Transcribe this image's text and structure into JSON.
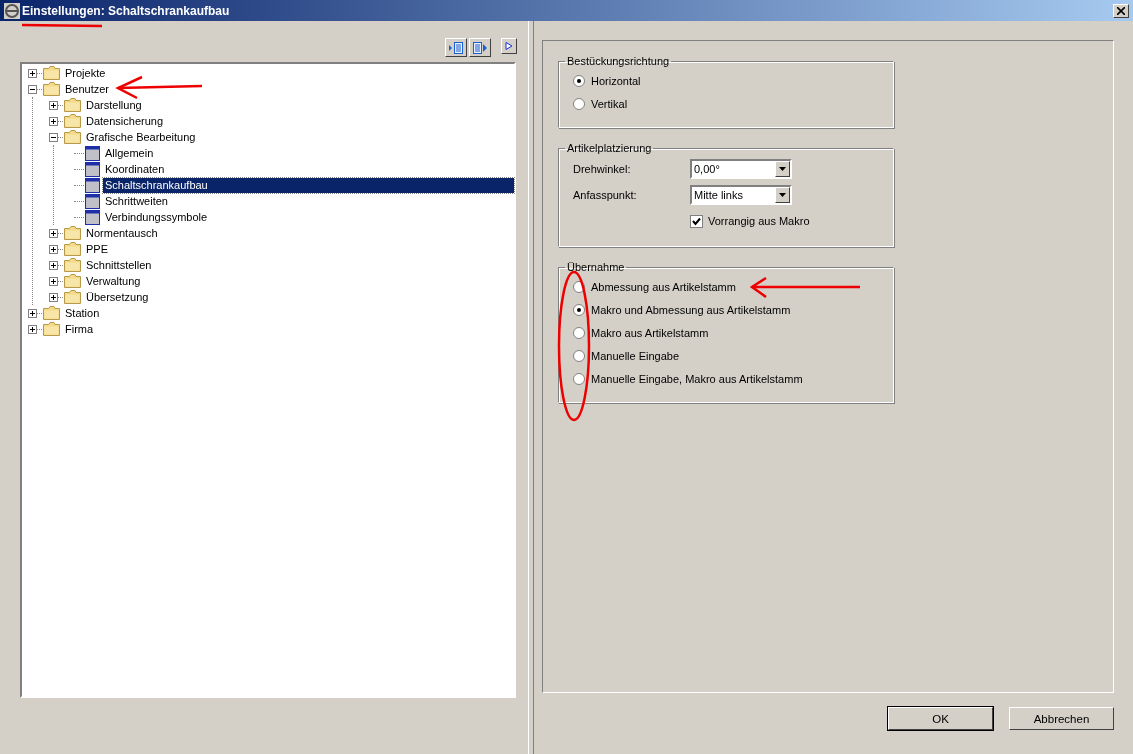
{
  "window": {
    "title": "Einstellungen: Schaltschrankaufbau"
  },
  "tree": [
    {
      "label": "Projekte",
      "kind": "folder",
      "expanded": false,
      "selected": false
    },
    {
      "label": "Benutzer",
      "kind": "folder",
      "expanded": true,
      "selected": false,
      "children": [
        {
          "label": "Darstellung",
          "kind": "folder",
          "expanded": false,
          "selected": false
        },
        {
          "label": "Datensicherung",
          "kind": "folder",
          "expanded": false,
          "selected": false
        },
        {
          "label": "Grafische Bearbeitung",
          "kind": "folder",
          "expanded": true,
          "selected": false,
          "children": [
            {
              "label": "Allgemein",
              "kind": "page",
              "selected": false
            },
            {
              "label": "Koordinaten",
              "kind": "page",
              "selected": false
            },
            {
              "label": "Schaltschrankaufbau",
              "kind": "page",
              "selected": true
            },
            {
              "label": "Schrittweiten",
              "kind": "page",
              "selected": false
            },
            {
              "label": "Verbindungssymbole",
              "kind": "page",
              "selected": false
            }
          ]
        },
        {
          "label": "Normentausch",
          "kind": "folder",
          "expanded": false,
          "selected": false
        },
        {
          "label": "PPE",
          "kind": "folder",
          "expanded": false,
          "selected": false
        },
        {
          "label": "Schnittstellen",
          "kind": "folder",
          "expanded": false,
          "selected": false
        },
        {
          "label": "Verwaltung",
          "kind": "folder",
          "expanded": false,
          "selected": false
        },
        {
          "label": "Übersetzung",
          "kind": "folder",
          "expanded": false,
          "selected": false
        }
      ]
    },
    {
      "label": "Station",
      "kind": "folder",
      "expanded": false,
      "selected": false
    },
    {
      "label": "Firma",
      "kind": "folder",
      "expanded": false,
      "selected": false
    }
  ],
  "groups": [
    {
      "title": "Bestückungsrichtung",
      "kind": "radios",
      "options": [
        {
          "label": "Horizontal",
          "selected": true
        },
        {
          "label": "Vertikal",
          "selected": false
        }
      ]
    },
    {
      "title": "Artikelplatzierung",
      "kind": "fields",
      "fields": [
        {
          "label": "Drehwinkel:",
          "value": "0,00°"
        },
        {
          "label": "Anfasspunkt:",
          "value": "Mitte links"
        }
      ],
      "checkbox": {
        "label": "Vorrangig aus Makro",
        "checked": true
      }
    },
    {
      "title": "Übernahme",
      "kind": "radios",
      "options": [
        {
          "label": "Abmessung aus Artikelstamm",
          "selected": false
        },
        {
          "label": "Makro und Abmessung aus Artikelstamm",
          "selected": true
        },
        {
          "label": "Makro aus Artikelstamm",
          "selected": false
        },
        {
          "label": "Manuelle Eingabe",
          "selected": false
        },
        {
          "label": "Manuelle Eingabe, Makro aus Artikelstamm",
          "selected": false
        }
      ]
    }
  ],
  "buttons": [
    "OK",
    "Abbrechen"
  ]
}
